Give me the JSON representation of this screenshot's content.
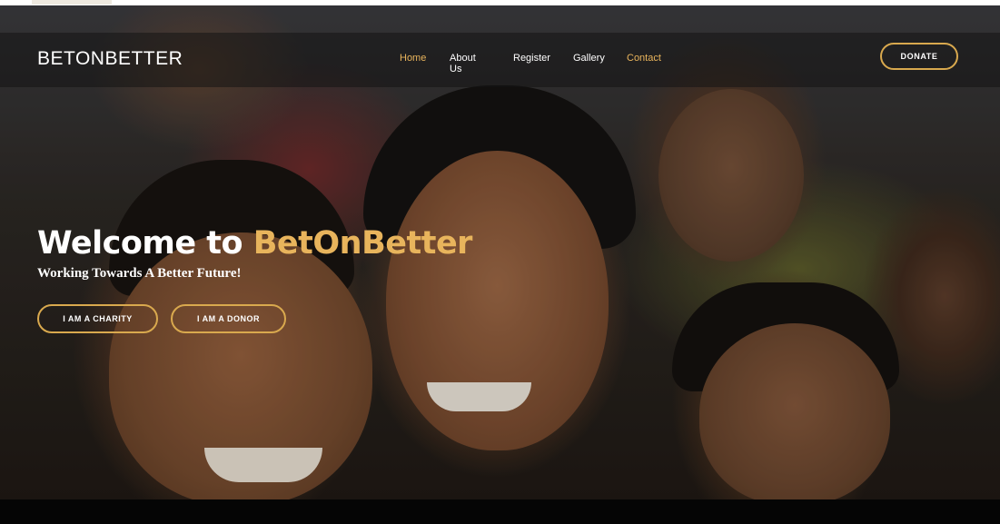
{
  "site": {
    "logo_text": "BETONBETTER"
  },
  "nav": {
    "items": [
      {
        "label": "Home",
        "active": true
      },
      {
        "label": "About Us"
      },
      {
        "label": "Register"
      },
      {
        "label": "Gallery"
      },
      {
        "label": "Contact"
      }
    ],
    "donate_label": "DONATE"
  },
  "hero": {
    "welcome_prefix": "Welcome to",
    "welcome_brand": "BetOnBetter",
    "tagline": "Working Towards A Better Future!",
    "buttons": [
      {
        "label": "I AM A CHARITY"
      },
      {
        "label": "I AM A DONOR"
      }
    ]
  },
  "colors": {
    "accent": "#e8b45c",
    "nav_background": "#141414",
    "text": "#ffffff"
  }
}
